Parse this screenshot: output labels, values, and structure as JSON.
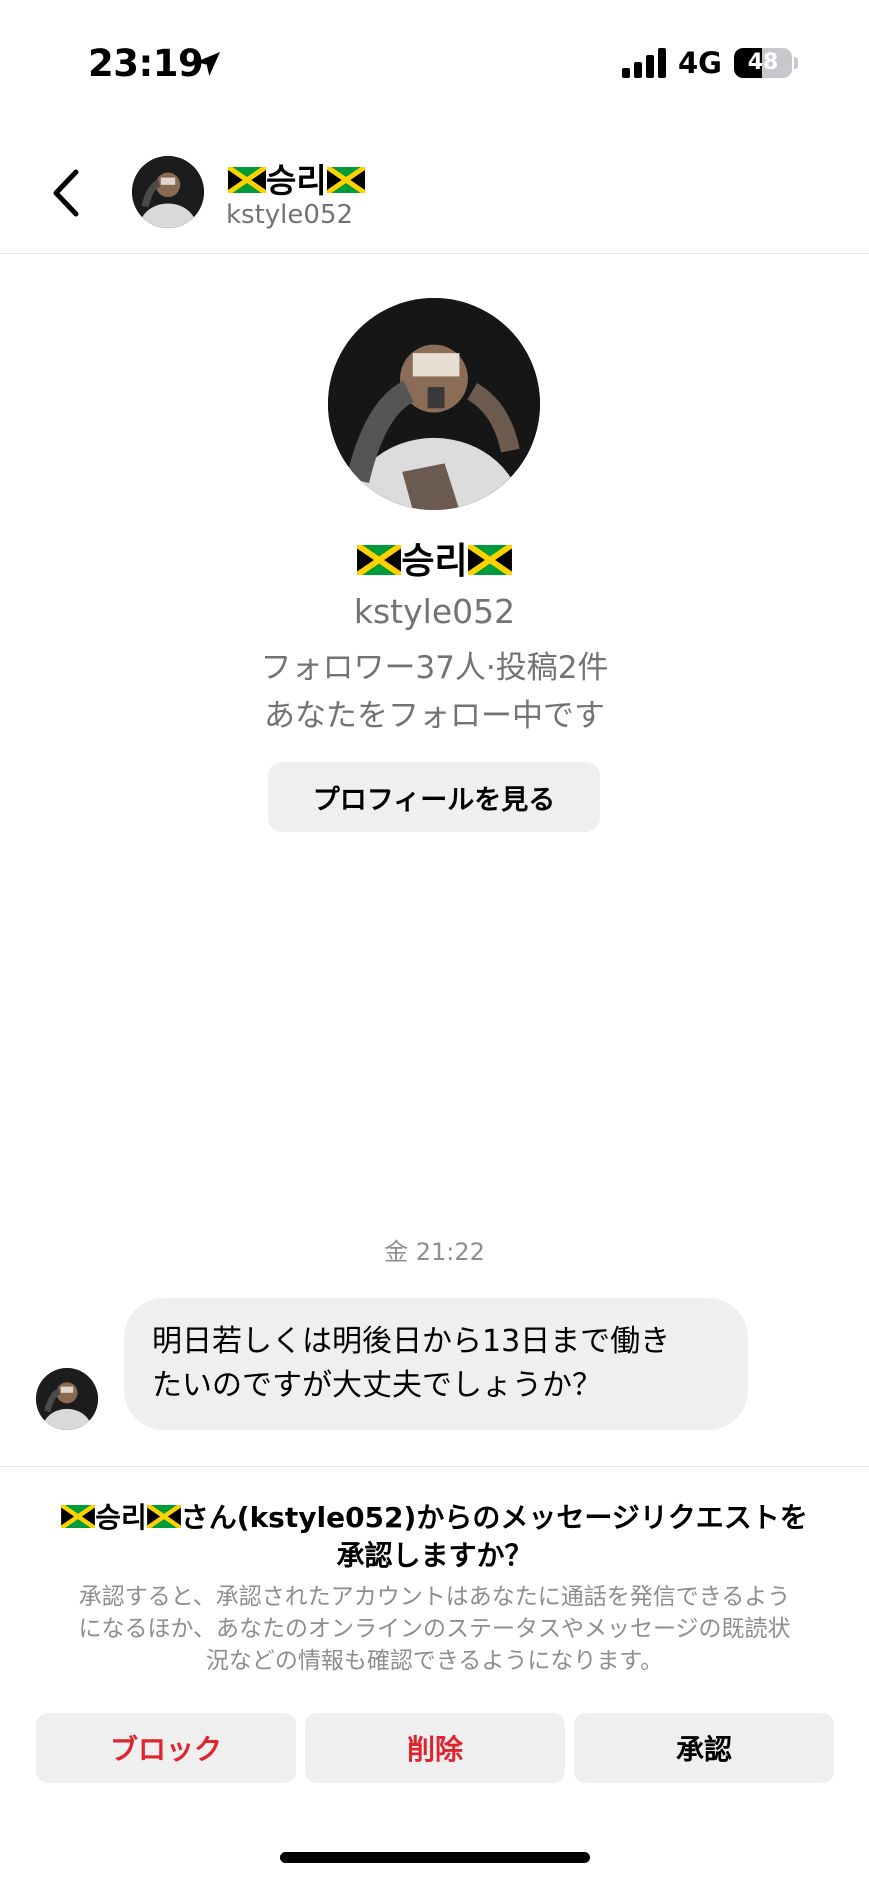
{
  "status_bar": {
    "time": "23:19",
    "network": "4G",
    "battery": "48",
    "battery_level": 0.48
  },
  "header": {
    "name": "승리",
    "username": "kstyle052",
    "flag_icon": "jamaica-flag-icon"
  },
  "profile": {
    "name": "승리",
    "username": "kstyle052",
    "stats": "フォロワー37人·投稿2件",
    "following_status": "あなたをフォロー中です",
    "view_profile_label": "プロフィールを見る"
  },
  "conversation": {
    "timestamp": "金 21:22",
    "message_line1": "明日若しくは明後日から13日まで働き",
    "message_line2": "たいのですが大丈夫でしょうか？"
  },
  "request": {
    "name": "승리",
    "title_part1": "さん(kstyle052)からのメッセージリクエストを",
    "title_part2": "承認しますか？",
    "description_line1": "承認すると、承認されたアカウントはあなたに通話を発信できるよう",
    "description_line2": "になるほか、あなたのオンラインのステータスやメッセージの既読状",
    "description_line3": "況などの情報も確認できるようになります。",
    "block_label": "ブロック",
    "delete_label": "削除",
    "accept_label": "承認"
  },
  "colors": {
    "destructive": "#e0242f",
    "secondary_text": "#737373",
    "button_bg": "#efefef"
  }
}
